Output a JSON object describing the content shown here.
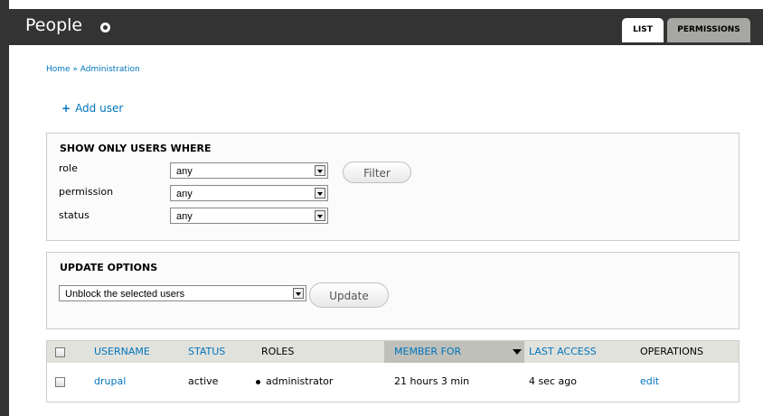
{
  "header": {
    "title": "People",
    "tabs": [
      {
        "label": "LIST",
        "active": true
      },
      {
        "label": "PERMISSIONS",
        "active": false
      }
    ]
  },
  "breadcrumb": "Home » Administration",
  "add_user": "Add user",
  "filter": {
    "legend": "SHOW ONLY USERS WHERE",
    "fields": [
      {
        "label": "role",
        "value": "any"
      },
      {
        "label": "permission",
        "value": "any"
      },
      {
        "label": "status",
        "value": "any"
      }
    ],
    "button": "Filter"
  },
  "update": {
    "legend": "UPDATE OPTIONS",
    "selected": "Unblock the selected users",
    "button": "Update"
  },
  "table": {
    "columns": [
      "USERNAME",
      "STATUS",
      "ROLES",
      "MEMBER FOR",
      "LAST ACCESS",
      "OPERATIONS"
    ],
    "rows": [
      {
        "username": "drupal",
        "status": "active",
        "roles": "administrator",
        "member_for": "21 hours 3 min",
        "last_access": "4 sec ago",
        "operations": "edit"
      }
    ]
  },
  "colors": {
    "link": "#0074bd",
    "header_bg": "#333333",
    "table_head": "#e1e2dc"
  }
}
